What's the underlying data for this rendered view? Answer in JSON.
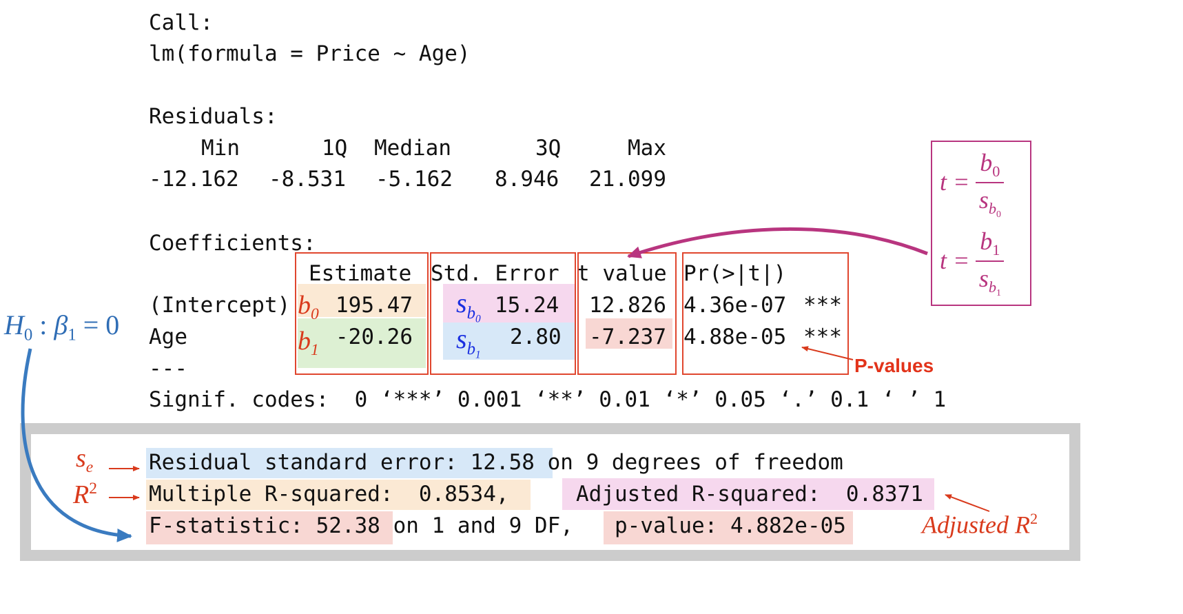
{
  "call": {
    "label": "Call:",
    "formula": "lm(formula = Price ~ Age)"
  },
  "residuals": {
    "label": "Residuals:",
    "headers": [
      "Min",
      "1Q",
      "Median",
      "3Q",
      "Max"
    ],
    "values": [
      "-12.162",
      "-8.531",
      "-5.162",
      "8.946",
      "21.099"
    ]
  },
  "coefficients": {
    "label": "Coefficients:",
    "headers": [
      "Estimate",
      "Std. Error",
      "t value",
      "Pr(>|t|)"
    ],
    "rows": [
      {
        "name": "(Intercept)",
        "estimate": "195.47",
        "std_error": "15.24",
        "t_value": "12.826",
        "p_value": "4.36e-07",
        "stars": "***"
      },
      {
        "name": "Age",
        "estimate": "-20.26",
        "std_error": "2.80",
        "t_value": "-7.237",
        "p_value": "4.88e-05",
        "stars": "***"
      }
    ],
    "separator": "---",
    "signif_codes": "Signif. codes:  0 ‘***’ 0.001 ‘**’ 0.01 ‘*’ 0.05 ‘.’ 0.1 ‘ ’ 1"
  },
  "summary": {
    "rse_label": "Residual standard error: 12.58",
    "rse_rest": " on 9 degrees of freedom",
    "r2_label": "Multiple R-squared:  0.8534,",
    "adj_r2_label": "Adjusted R-squared:  0.8371",
    "f_label": "F-statistic: 52.38",
    "f_rest": " on 1 and 9 DF,",
    "pvalue_label": "p-value: 4.882e-05"
  },
  "annotations": {
    "hypothesis": "H0 : β1 = 0",
    "p_values": "P-values",
    "adjusted_r2": "Adjusted R2",
    "b0": "b0",
    "b1": "b1",
    "sb0": "sb0",
    "sb1": "sb1",
    "se": "se",
    "r2": "R2",
    "t_formula_1": "t = b0 / sb0",
    "t_formula_2": "t = b1 / sb1"
  },
  "colors": {
    "orange_hl": "#fbe9d4",
    "green_hl": "#ddf0d3",
    "pink_hl": "#f6d8ee",
    "blue_hl": "#d7e8f8",
    "red_hl": "#f8d7d3",
    "box_red": "#e0462e",
    "magenta": "#b8357f",
    "arrow_blue": "#3a7bc0",
    "frame_gray": "#cccccc"
  }
}
